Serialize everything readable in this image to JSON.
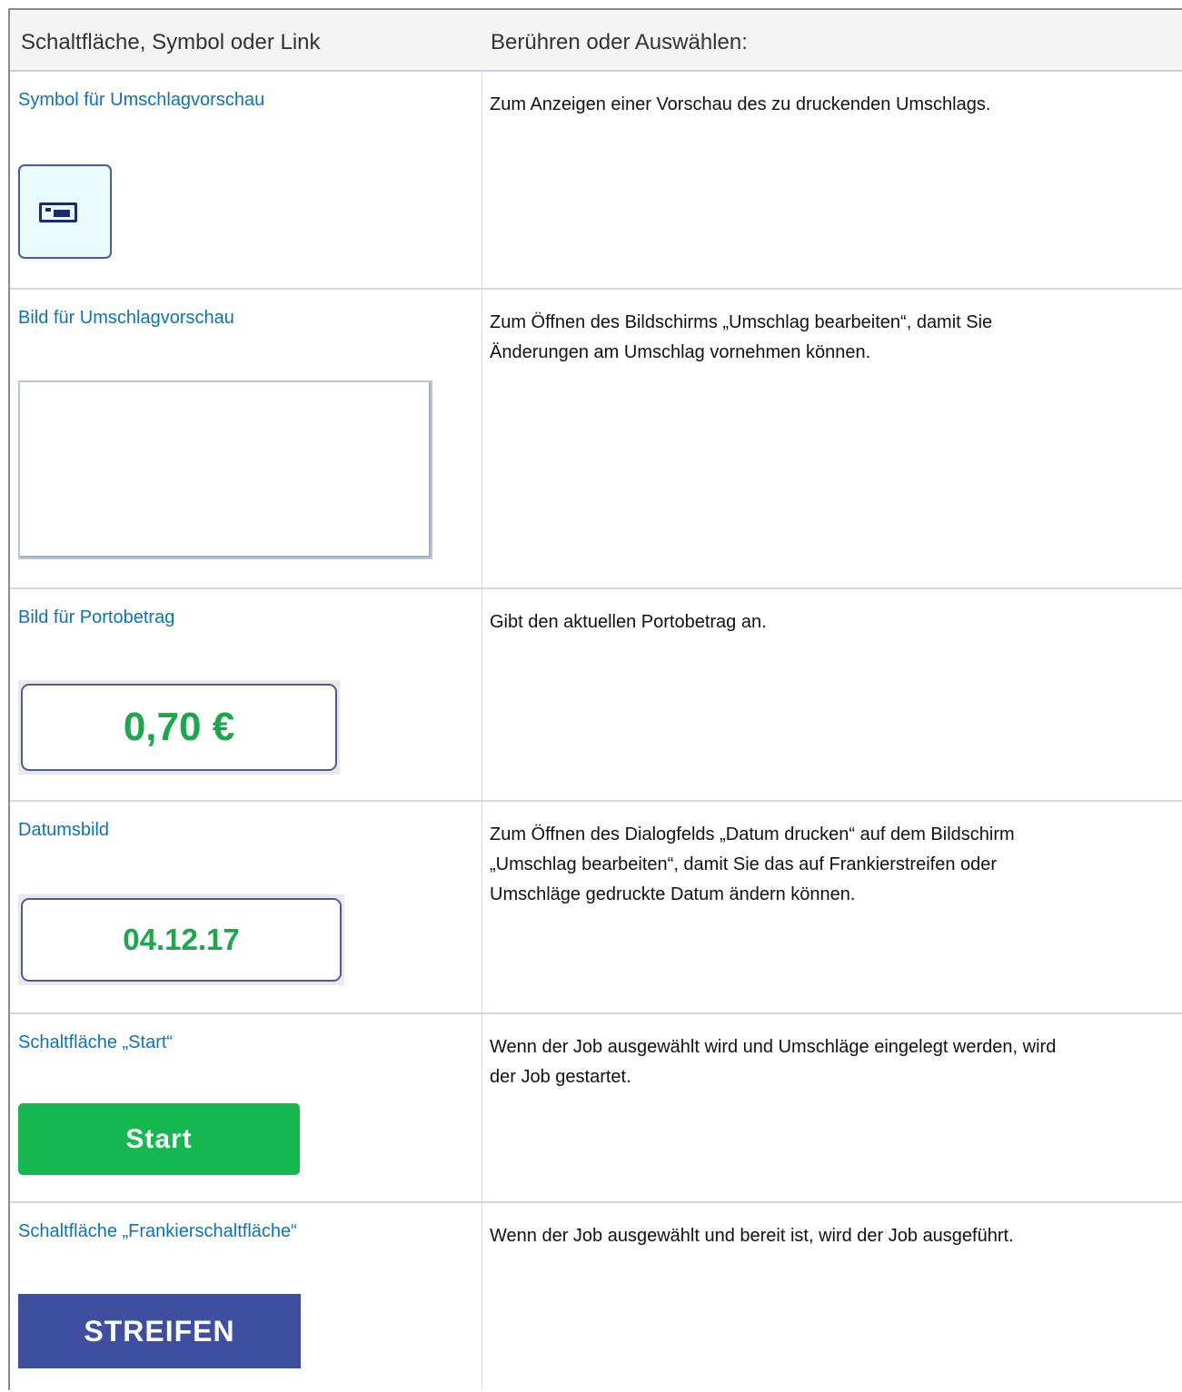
{
  "header": {
    "col1": "Schaltfläche, Symbol oder Link",
    "col2": "Berühren oder Auswählen:"
  },
  "rows": [
    {
      "label": "Symbol für Umschlagvorschau",
      "description": [
        "Zum Anzeigen einer Vorschau des zu druckenden Umschlags."
      ],
      "sample": {
        "kind": "envelope-icon",
        "icon": "envelope-icon"
      }
    },
    {
      "label": "Bild für Umschlagvorschau",
      "description": [
        "Zum Öffnen des Bildschirms „Umschlag bearbeiten“, damit Sie",
        "Änderungen am Umschlag vornehmen können."
      ],
      "sample": {
        "kind": "blank-preview"
      }
    },
    {
      "label": "Bild für Portobetrag",
      "description": [
        "Gibt den aktuellen Portobetrag an."
      ],
      "sample": {
        "kind": "amount",
        "text": "0,70 €"
      }
    },
    {
      "label": "Datumsbild",
      "description": [
        "Zum Öffnen des Dialogfelds „Datum drucken“ auf dem Bildschirm",
        "„Umschlag bearbeiten“, damit Sie das auf Frankierstreifen oder",
        "Umschläge gedruckte Datum ändern können."
      ],
      "sample": {
        "kind": "date",
        "text": "04.12.17"
      }
    },
    {
      "label": "Schaltfläche „Start“",
      "description": [
        "Wenn der Job ausgewählt wird und Umschläge eingelegt werden, wird",
        "der Job gestartet."
      ],
      "sample": {
        "kind": "start-button",
        "text": "Start"
      }
    },
    {
      "label": "Schaltfläche „Frankierschaltfläche“",
      "description": [
        "Wenn der Job ausgewählt und bereit ist, wird der Job ausgeführt."
      ],
      "sample": {
        "kind": "stamp-button",
        "text": "STREIFEN"
      }
    }
  ],
  "colors": {
    "link": "#0a74b8",
    "amount_green": "#1aa84a",
    "start_green": "#14b84e",
    "stamp_blue": "#3e4f9f",
    "icon_border": "#4a5aa8"
  }
}
